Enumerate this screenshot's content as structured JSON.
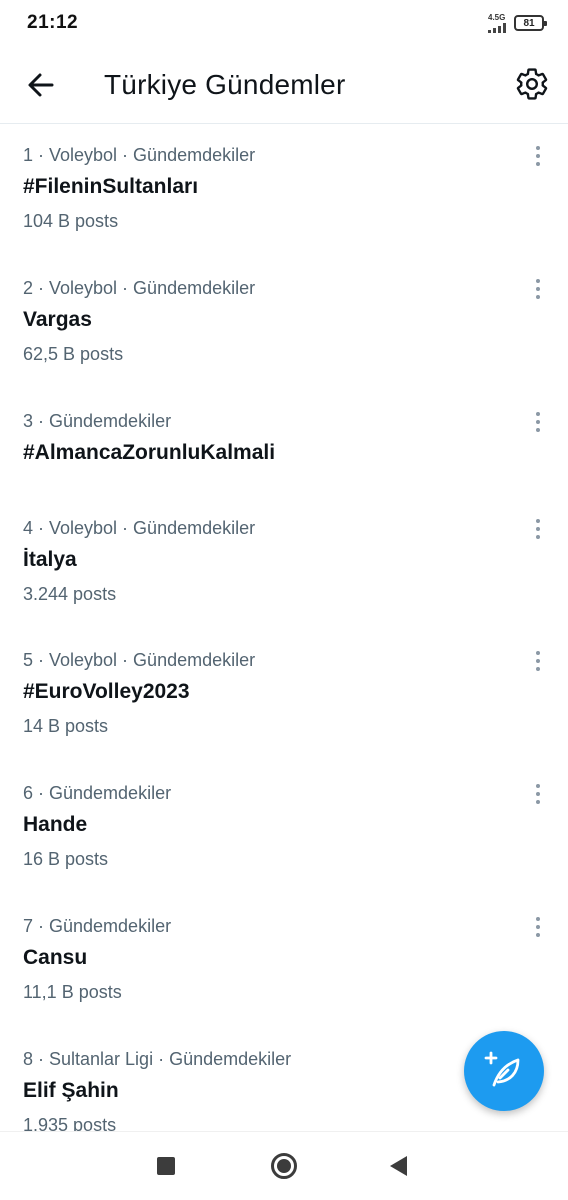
{
  "status_bar": {
    "time": "21:12",
    "network": "4.5G",
    "battery": "81"
  },
  "header": {
    "title": "Türkiye Gündemler",
    "back_icon": "arrow-left-icon",
    "settings_icon": "gear-icon"
  },
  "trends": [
    {
      "meta": "1 · Voleybol · Gündemdekiler",
      "name": "#FileninSultanları",
      "count": "104 B posts"
    },
    {
      "meta": "2 · Voleybol · Gündemdekiler",
      "name": "Vargas",
      "count": "62,5 B posts"
    },
    {
      "meta": "3 · Gündemdekiler",
      "name": "#AlmancaZorunluKalmali",
      "count": ""
    },
    {
      "meta": "4 · Voleybol · Gündemdekiler",
      "name": "İtalya",
      "count": "3.244 posts"
    },
    {
      "meta": "5 · Voleybol · Gündemdekiler",
      "name": "#EuroVolley2023",
      "count": "14 B posts"
    },
    {
      "meta": "6 · Gündemdekiler",
      "name": "Hande",
      "count": "16 B posts"
    },
    {
      "meta": "7 · Gündemdekiler",
      "name": "Cansu",
      "count": "11,1 B posts"
    },
    {
      "meta": "8 · Sultanlar Ligi · Gündemdekiler",
      "name": "Elif Şahin",
      "count": "1.935 posts"
    }
  ],
  "fab": {
    "icon": "compose-feather-icon"
  },
  "colors": {
    "accent": "#1d9bf0",
    "text_primary": "#0f1419",
    "text_secondary": "#536471"
  }
}
